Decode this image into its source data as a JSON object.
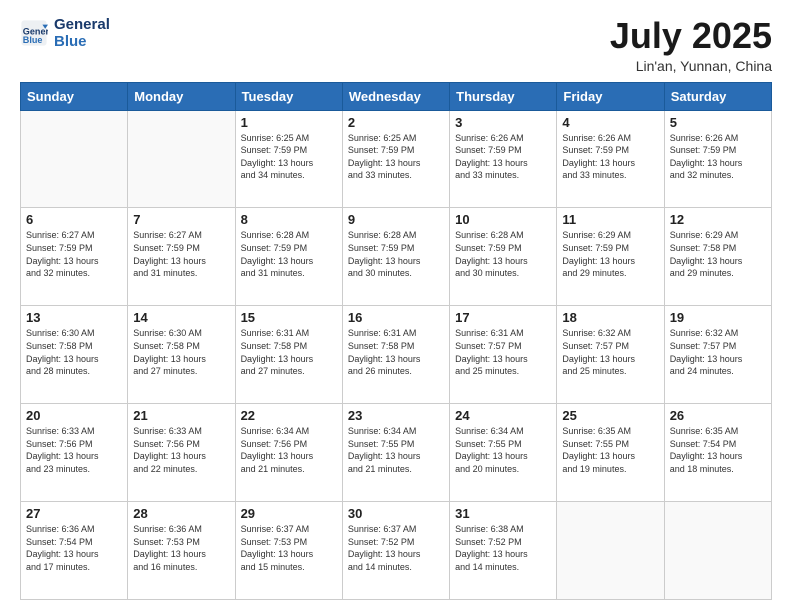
{
  "header": {
    "logo_line1": "General",
    "logo_line2": "Blue",
    "title": "July 2025",
    "subtitle": "Lin'an, Yunnan, China"
  },
  "weekdays": [
    "Sunday",
    "Monday",
    "Tuesday",
    "Wednesday",
    "Thursday",
    "Friday",
    "Saturday"
  ],
  "weeks": [
    [
      {
        "day": "",
        "info": ""
      },
      {
        "day": "",
        "info": ""
      },
      {
        "day": "1",
        "info": "Sunrise: 6:25 AM\nSunset: 7:59 PM\nDaylight: 13 hours\nand 34 minutes."
      },
      {
        "day": "2",
        "info": "Sunrise: 6:25 AM\nSunset: 7:59 PM\nDaylight: 13 hours\nand 33 minutes."
      },
      {
        "day": "3",
        "info": "Sunrise: 6:26 AM\nSunset: 7:59 PM\nDaylight: 13 hours\nand 33 minutes."
      },
      {
        "day": "4",
        "info": "Sunrise: 6:26 AM\nSunset: 7:59 PM\nDaylight: 13 hours\nand 33 minutes."
      },
      {
        "day": "5",
        "info": "Sunrise: 6:26 AM\nSunset: 7:59 PM\nDaylight: 13 hours\nand 32 minutes."
      }
    ],
    [
      {
        "day": "6",
        "info": "Sunrise: 6:27 AM\nSunset: 7:59 PM\nDaylight: 13 hours\nand 32 minutes."
      },
      {
        "day": "7",
        "info": "Sunrise: 6:27 AM\nSunset: 7:59 PM\nDaylight: 13 hours\nand 31 minutes."
      },
      {
        "day": "8",
        "info": "Sunrise: 6:28 AM\nSunset: 7:59 PM\nDaylight: 13 hours\nand 31 minutes."
      },
      {
        "day": "9",
        "info": "Sunrise: 6:28 AM\nSunset: 7:59 PM\nDaylight: 13 hours\nand 30 minutes."
      },
      {
        "day": "10",
        "info": "Sunrise: 6:28 AM\nSunset: 7:59 PM\nDaylight: 13 hours\nand 30 minutes."
      },
      {
        "day": "11",
        "info": "Sunrise: 6:29 AM\nSunset: 7:59 PM\nDaylight: 13 hours\nand 29 minutes."
      },
      {
        "day": "12",
        "info": "Sunrise: 6:29 AM\nSunset: 7:58 PM\nDaylight: 13 hours\nand 29 minutes."
      }
    ],
    [
      {
        "day": "13",
        "info": "Sunrise: 6:30 AM\nSunset: 7:58 PM\nDaylight: 13 hours\nand 28 minutes."
      },
      {
        "day": "14",
        "info": "Sunrise: 6:30 AM\nSunset: 7:58 PM\nDaylight: 13 hours\nand 27 minutes."
      },
      {
        "day": "15",
        "info": "Sunrise: 6:31 AM\nSunset: 7:58 PM\nDaylight: 13 hours\nand 27 minutes."
      },
      {
        "day": "16",
        "info": "Sunrise: 6:31 AM\nSunset: 7:58 PM\nDaylight: 13 hours\nand 26 minutes."
      },
      {
        "day": "17",
        "info": "Sunrise: 6:31 AM\nSunset: 7:57 PM\nDaylight: 13 hours\nand 25 minutes."
      },
      {
        "day": "18",
        "info": "Sunrise: 6:32 AM\nSunset: 7:57 PM\nDaylight: 13 hours\nand 25 minutes."
      },
      {
        "day": "19",
        "info": "Sunrise: 6:32 AM\nSunset: 7:57 PM\nDaylight: 13 hours\nand 24 minutes."
      }
    ],
    [
      {
        "day": "20",
        "info": "Sunrise: 6:33 AM\nSunset: 7:56 PM\nDaylight: 13 hours\nand 23 minutes."
      },
      {
        "day": "21",
        "info": "Sunrise: 6:33 AM\nSunset: 7:56 PM\nDaylight: 13 hours\nand 22 minutes."
      },
      {
        "day": "22",
        "info": "Sunrise: 6:34 AM\nSunset: 7:56 PM\nDaylight: 13 hours\nand 21 minutes."
      },
      {
        "day": "23",
        "info": "Sunrise: 6:34 AM\nSunset: 7:55 PM\nDaylight: 13 hours\nand 21 minutes."
      },
      {
        "day": "24",
        "info": "Sunrise: 6:34 AM\nSunset: 7:55 PM\nDaylight: 13 hours\nand 20 minutes."
      },
      {
        "day": "25",
        "info": "Sunrise: 6:35 AM\nSunset: 7:55 PM\nDaylight: 13 hours\nand 19 minutes."
      },
      {
        "day": "26",
        "info": "Sunrise: 6:35 AM\nSunset: 7:54 PM\nDaylight: 13 hours\nand 18 minutes."
      }
    ],
    [
      {
        "day": "27",
        "info": "Sunrise: 6:36 AM\nSunset: 7:54 PM\nDaylight: 13 hours\nand 17 minutes."
      },
      {
        "day": "28",
        "info": "Sunrise: 6:36 AM\nSunset: 7:53 PM\nDaylight: 13 hours\nand 16 minutes."
      },
      {
        "day": "29",
        "info": "Sunrise: 6:37 AM\nSunset: 7:53 PM\nDaylight: 13 hours\nand 15 minutes."
      },
      {
        "day": "30",
        "info": "Sunrise: 6:37 AM\nSunset: 7:52 PM\nDaylight: 13 hours\nand 14 minutes."
      },
      {
        "day": "31",
        "info": "Sunrise: 6:38 AM\nSunset: 7:52 PM\nDaylight: 13 hours\nand 14 minutes."
      },
      {
        "day": "",
        "info": ""
      },
      {
        "day": "",
        "info": ""
      }
    ]
  ]
}
